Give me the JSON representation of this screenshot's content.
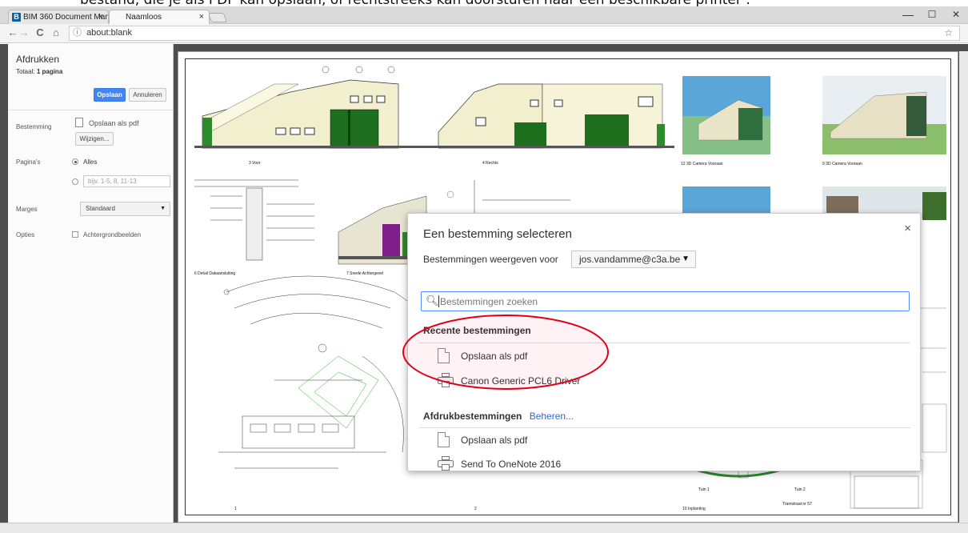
{
  "caption": "bestand, die je als PDF kan opslaan, of rechtstreeks kan doorsturen naar een beschikbare printer :",
  "browser": {
    "tabs": [
      {
        "label": "BIM 360 Document Man",
        "favicon": "B"
      },
      {
        "label": "Naamloos"
      }
    ],
    "tab_close": "×",
    "profile_name": "⁣⁣",
    "window_buttons": {
      "minimize": "—",
      "maximize": "☐",
      "close": "✕"
    },
    "nav": {
      "back": "←",
      "forward": "→",
      "reload": "C",
      "home": "⌂"
    },
    "address": "about:blank",
    "info_icon": "ⓘ",
    "star": "☆",
    "menu": "⋮"
  },
  "print_panel": {
    "title": "Afdrukken",
    "total_prefix": "Totaal:",
    "total_value": "1 pagina",
    "save_button": "Opslaan",
    "cancel_button": "Annuleren",
    "destination_label": "Bestemming",
    "destination_value": "Opslaan als pdf",
    "change_button": "Wijzigen...",
    "pages_label": "Pagina's",
    "pages_all": "Alles",
    "pages_placeholder": "bijv. 1-5, 8, 11-13",
    "margins_label": "Marges",
    "margins_value": "Standaard",
    "options_label": "Opties",
    "background_graphics": "Achtergrondbeelden"
  },
  "sheet": {
    "view_labels": [
      {
        "num": "3",
        "name": "Voor"
      },
      {
        "num": "4",
        "name": "Rechts"
      },
      {
        "num": "12",
        "name": "3D Camera Vooraan"
      },
      {
        "num": "9",
        "name": "3D Camera Vooraan"
      },
      {
        "num": "6",
        "name": "Detail Dakaansluiting"
      },
      {
        "num": "7",
        "name": "Snede Achtergevel"
      },
      {
        "num": "1",
        "name": ""
      },
      {
        "num": "2",
        "name": ""
      },
      {
        "num": "10",
        "name": "Inplanting"
      }
    ],
    "small_labels": [
      "Tramstraat nr 57",
      "Tuin 1",
      "Tuin 2"
    ]
  },
  "dialog": {
    "title": "Een bestemming selecteren",
    "close": "×",
    "show_for_label": "Bestemmingen weergeven voor",
    "account": "jos.vandamme@c3a.be",
    "search_placeholder": "Bestemmingen zoeken",
    "recent_header": "Recente bestemmingen",
    "recent": [
      {
        "label": "Opslaan als pdf",
        "icon": "document-icon"
      },
      {
        "label": "Canon Generic PCL6 Driver",
        "icon": "printer-icon"
      }
    ],
    "print_header": "Afdrukbestemmingen",
    "manage_link": "Beheren...",
    "print_destinations": [
      {
        "label": "Opslaan als pdf",
        "icon": "document-icon"
      },
      {
        "label": "Send To OneNote 2016",
        "icon": "printer-icon"
      }
    ]
  },
  "colors": {
    "accent": "#4285f4",
    "highlight_circle": "#e0001a",
    "preview_bg": "#4e4e4e",
    "building_green": "#1f6b1f"
  }
}
